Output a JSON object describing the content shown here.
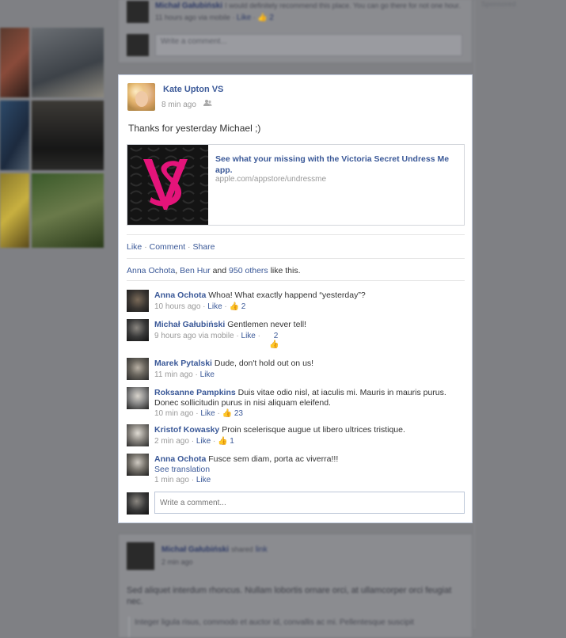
{
  "background": {
    "top_comment_text": "I would definitely recommend this place. You can go there for not one hour.",
    "top_comment_author": "Michał Gałubiński",
    "top_comment_meta": "11 hours ago via mobile",
    "top_comment_like": "Like",
    "top_comment_count": "2",
    "top_write_placeholder": "Write a comment...",
    "right_muted": "Sponsored",
    "bottom_post_author": "Michał Gałubiński",
    "bottom_post_action": "shared",
    "bottom_post_link": "link",
    "bottom_post_meta": "2 min ago",
    "bottom_post_text": "Sed aliquet interdum rhoncus. Nullam lobortis ornare orci, at ullamcorper orci feugiat nec.",
    "bottom_post_quote": "Integer ligula risus, commodo et auctor id, convallis ac mi. Pellentesque suscipit"
  },
  "post": {
    "author": "Kate Upton VS",
    "time": "8 min ago",
    "status": "Thanks for yesterday Michael ;)",
    "attachment": {
      "title": "See what your missing with the Victoria Secret Undress Me app.",
      "url": "apple.com/appstore/undressme",
      "logo_text": "VS"
    },
    "actions": {
      "like": "Like",
      "comment": "Comment",
      "share": "Share",
      "sep": "·"
    },
    "likes": {
      "person1": "Anna Ochota",
      "sep1": ",",
      "person2": "Ben Hur",
      "and": "and",
      "others": "950 others",
      "suffix": "like this."
    },
    "comments": [
      {
        "name": "Anna Ochota",
        "text": "Whoa! What exactly happend “yesterday”?",
        "time": "10 hours ago",
        "like": "Like",
        "count": "2"
      },
      {
        "name": "Michał Gałubiński",
        "text": "Gentlemen never tell!",
        "time": "9 hours ago via mobile",
        "like": "Like",
        "count": "2"
      },
      {
        "name": "Marek Pytalski",
        "text": "Dude, don't hold out on us!",
        "time": "11 min ago",
        "like": "Like",
        "count": ""
      },
      {
        "name": "Roksanne Pampkins",
        "text": "Duis vitae odio nisl, at iaculis mi. Mauris in mauris purus. Donec sollicitudin purus in nisi aliquam eleifend.",
        "time": "10 min ago",
        "like": "Like",
        "count": "23"
      },
      {
        "name": "Kristof Kowasky",
        "text": "Proin scelerisque augue ut libero ultrices tristique.",
        "time": "2 min ago",
        "like": "Like",
        "count": "1"
      },
      {
        "name": "Anna Ochota",
        "text": "Fusce sem diam, porta ac viverra!!!",
        "translation": "See translation",
        "time": "1 min ago",
        "like": "Like",
        "count": ""
      }
    ],
    "write_placeholder": "Write a comment..."
  },
  "colors": {
    "link": "#3b5998",
    "logo_pink": "#e4147a",
    "background": "#7f8084"
  }
}
